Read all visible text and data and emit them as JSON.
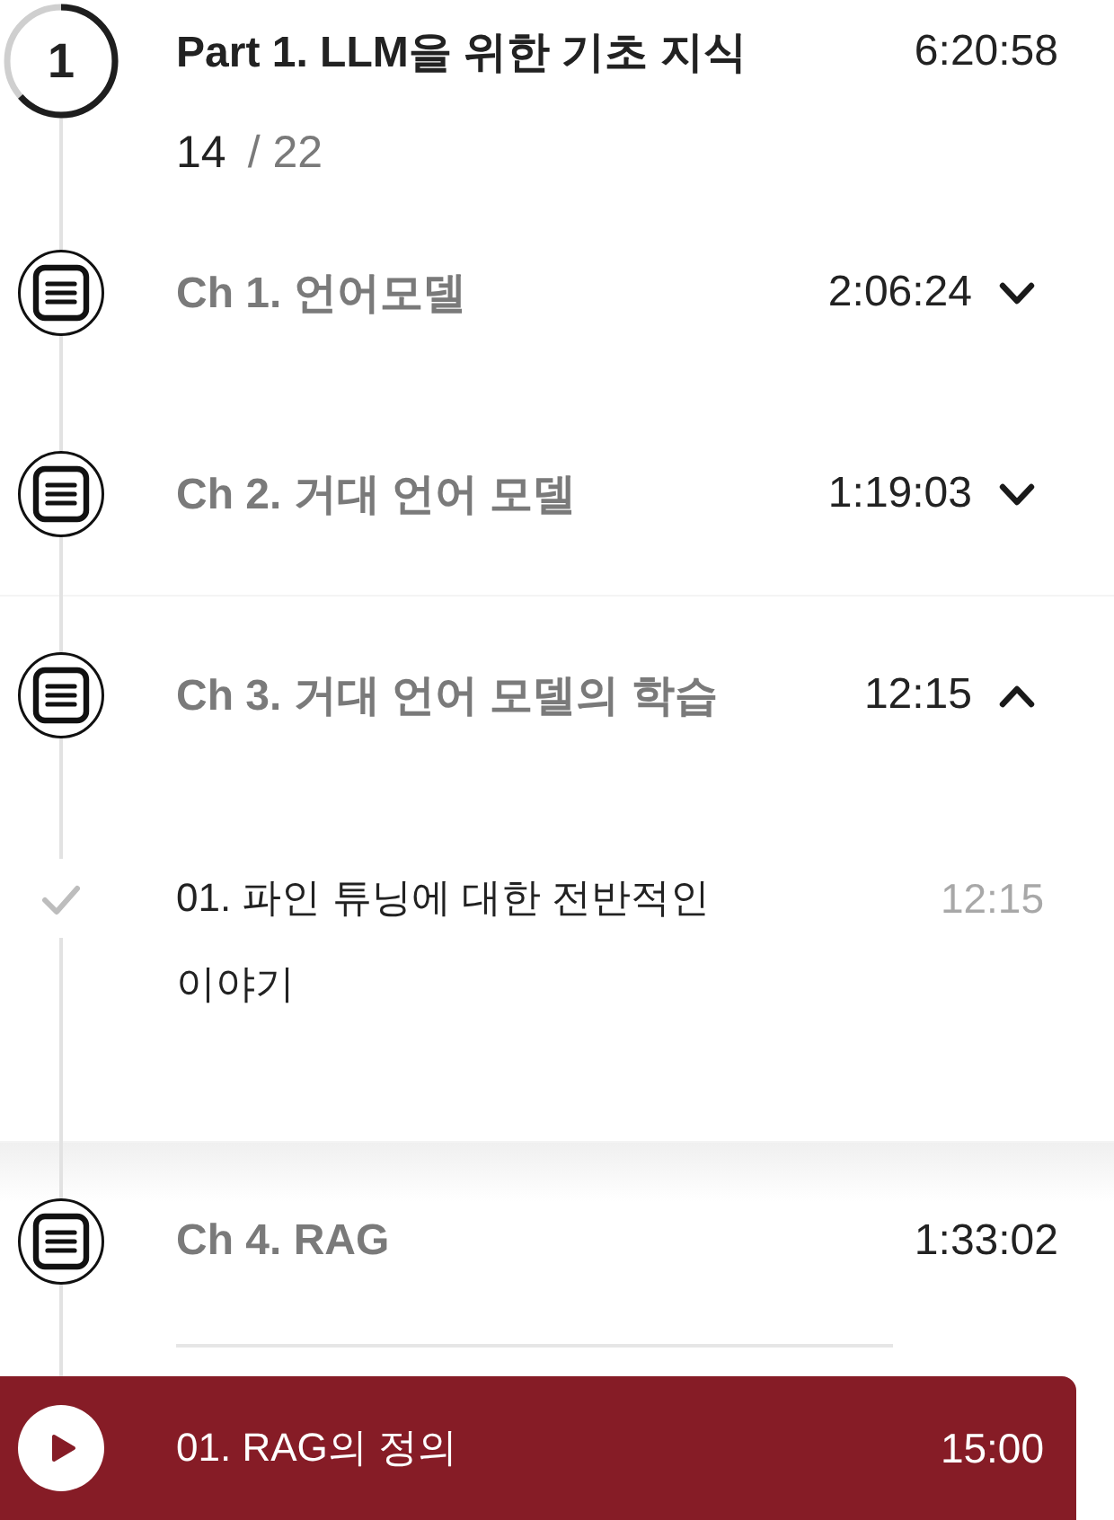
{
  "part": {
    "number": "1",
    "title": "Part 1. LLM을 위한 기초 지식",
    "duration": "6:20:58",
    "done": "14",
    "total": "/ 22",
    "level": 0.636
  },
  "chapters": [
    {
      "title": "Ch 1. 언어모델",
      "duration": "2:06:24",
      "expanded": false,
      "current": false
    },
    {
      "title": "Ch 2. 거대 언어 모델",
      "duration": "1:19:03",
      "expanded": false,
      "current": false
    },
    {
      "title": "Ch 3. 거대 언어 모델의 학습",
      "duration": "12:15",
      "expanded": true,
      "current": false,
      "lessons": [
        {
          "title": "01. 파인 튜닝에 대한 전반적인 이야기",
          "duration": "12:15",
          "completed": true,
          "selected": false
        }
      ]
    },
    {
      "title": "Ch 4. RAG",
      "duration": "1:33:02",
      "expanded": true,
      "current": true,
      "lessons": [
        {
          "title": "01. RAG의 정의",
          "duration": "15:00",
          "completed": false,
          "selected": true
        }
      ]
    }
  ]
}
